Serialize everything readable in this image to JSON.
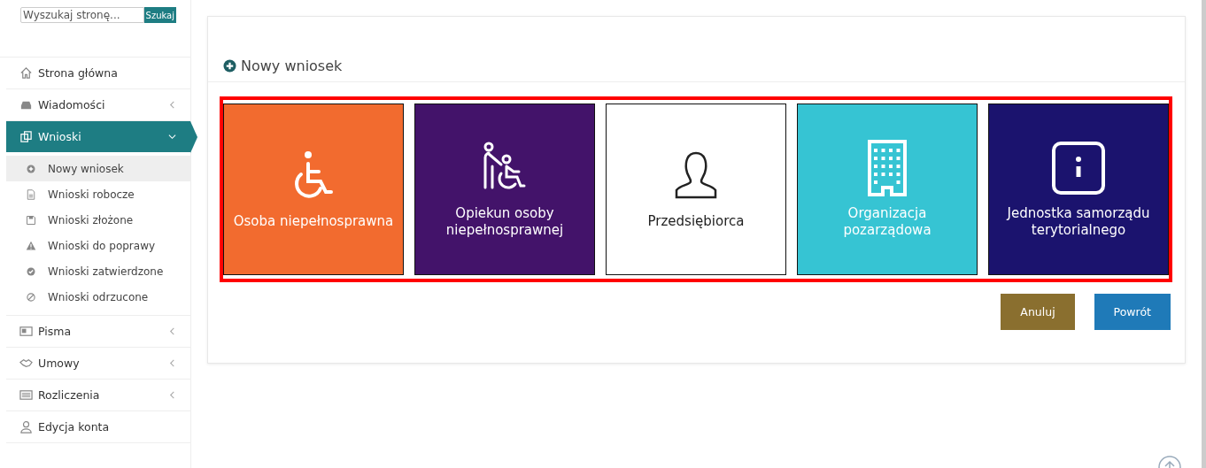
{
  "search": {
    "placeholder": "Wyszukaj stronę...",
    "button": "Szukaj"
  },
  "nav": [
    {
      "label": "Strona główna",
      "selected": false
    },
    {
      "label": "Wiadomości",
      "selected": false,
      "expanded": false
    },
    {
      "label": "Wnioski",
      "selected": true,
      "expanded": true,
      "children": [
        {
          "label": "Nowy wniosek",
          "selected": true
        },
        {
          "label": "Wnioski robocze",
          "selected": false
        },
        {
          "label": "Wnioski złożone",
          "selected": false
        },
        {
          "label": "Wnioski do poprawy",
          "selected": false
        },
        {
          "label": "Wnioski zatwierdzone",
          "selected": false
        },
        {
          "label": "Wnioski odrzucone",
          "selected": false
        }
      ]
    },
    {
      "label": "Pisma",
      "selected": false,
      "expanded": false
    },
    {
      "label": "Umowy",
      "selected": false,
      "expanded": false
    },
    {
      "label": "Rozliczenia",
      "selected": false,
      "expanded": false
    },
    {
      "label": "Edycja konta",
      "selected": false
    }
  ],
  "panel": {
    "title": "Nowy wniosek",
    "tiles": [
      {
        "label": "Osoba niepełnosprawna",
        "color": "#f26b2f"
      },
      {
        "label": "Opiekun osoby niepełnosprawnej",
        "color": "#43136a"
      },
      {
        "label": "Przedsiębiorca",
        "color": "#ffffff"
      },
      {
        "label": "Organizacja pozarządowa",
        "color": "#36c4d3"
      },
      {
        "label": "Jednostka samorządu terytorialnego",
        "color": "#1b136e"
      }
    ],
    "buttons": [
      {
        "label": "Anuluj",
        "kind": "cancel"
      },
      {
        "label": "Powrót",
        "kind": "back"
      }
    ]
  }
}
